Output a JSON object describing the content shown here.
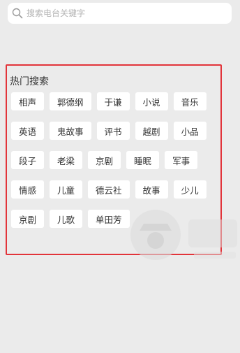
{
  "search": {
    "placeholder": "搜索电台关键字",
    "icon": "search-icon"
  },
  "hot_search": {
    "title": "热门搜索",
    "rows": [
      [
        "相声",
        "郭德纲",
        "于谦",
        "小说",
        "音乐"
      ],
      [
        "英语",
        "鬼故事",
        "评书",
        "越剧",
        "小品"
      ],
      [
        "段子",
        "老梁",
        "京剧",
        "睡眠",
        "军事"
      ],
      [
        "情感",
        "儿童",
        "德云社",
        "故事",
        "少儿"
      ],
      [
        "京剧",
        "儿歌",
        "单田芳"
      ]
    ]
  },
  "colors": {
    "background": "#ebebeb",
    "highlight_border": "#e2343a",
    "tag_background": "#ffffff",
    "text": "#333333"
  }
}
